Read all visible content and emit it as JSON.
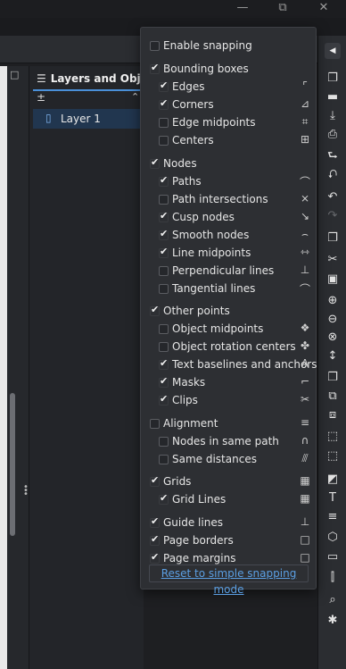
{
  "window_controls": {
    "minimize": "—",
    "maximize": "⧉",
    "close": "✕"
  },
  "layers_panel": {
    "tab_title": "Layers and Objec",
    "tab_icon": "☰",
    "add_glyph": "±",
    "up_glyph": "⌃",
    "layers": [
      {
        "name": "Layer 1",
        "icon": "▯"
      }
    ]
  },
  "snapping": {
    "options": [
      {
        "label": "Enable snapping",
        "checked": false,
        "level": 0,
        "icon": ""
      },
      {
        "label": "Bounding boxes",
        "checked": true,
        "level": 0,
        "icon": ""
      },
      {
        "label": "Edges",
        "checked": true,
        "level": 1,
        "icon": "⌜"
      },
      {
        "label": "Corners",
        "checked": true,
        "level": 1,
        "icon": "⊿"
      },
      {
        "label": "Edge midpoints",
        "checked": false,
        "level": 1,
        "icon": "⌗"
      },
      {
        "label": "Centers",
        "checked": false,
        "level": 1,
        "icon": "⊞"
      },
      {
        "label": "Nodes",
        "checked": true,
        "level": 0,
        "icon": ""
      },
      {
        "label": "Paths",
        "checked": true,
        "level": 1,
        "icon": "⌒"
      },
      {
        "label": "Path intersections",
        "checked": false,
        "level": 1,
        "icon": "⨯"
      },
      {
        "label": "Cusp nodes",
        "checked": true,
        "level": 1,
        "icon": "↘"
      },
      {
        "label": "Smooth nodes",
        "checked": true,
        "level": 1,
        "icon": "⌢"
      },
      {
        "label": "Line midpoints",
        "checked": true,
        "level": 1,
        "icon": "⇿"
      },
      {
        "label": "Perpendicular lines",
        "checked": false,
        "level": 1,
        "icon": "⊥"
      },
      {
        "label": "Tangential lines",
        "checked": false,
        "level": 1,
        "icon": "⌒"
      },
      {
        "label": "Other points",
        "checked": true,
        "level": 0,
        "icon": ""
      },
      {
        "label": "Object midpoints",
        "checked": false,
        "level": 1,
        "icon": "❖"
      },
      {
        "label": "Object rotation centers",
        "checked": false,
        "level": 1,
        "icon": "✤"
      },
      {
        "label": "Text baselines and anchors",
        "checked": true,
        "level": 1,
        "icon": "A"
      },
      {
        "label": "Masks",
        "checked": true,
        "level": 1,
        "icon": "⌐"
      },
      {
        "label": "Clips",
        "checked": true,
        "level": 1,
        "icon": "✂"
      },
      {
        "label": "Alignment",
        "checked": false,
        "level": 0,
        "icon": "≡"
      },
      {
        "label": "Nodes in same path",
        "checked": false,
        "level": 1,
        "icon": "∩"
      },
      {
        "label": "Same distances",
        "checked": false,
        "level": 1,
        "icon": "⫻"
      },
      {
        "label": "Grids",
        "checked": true,
        "level": 0,
        "icon": "▦"
      },
      {
        "label": "Grid Lines",
        "checked": true,
        "level": 1,
        "icon": "▦"
      },
      {
        "label": "Guide lines",
        "checked": true,
        "level": 0,
        "icon": "⊥"
      },
      {
        "label": "Page borders",
        "checked": true,
        "level": 0,
        "icon": "□"
      },
      {
        "label": "Page margins",
        "checked": true,
        "level": 0,
        "icon": "□"
      }
    ],
    "reset_link": "Reset to simple snapping mode"
  },
  "toolbar": {
    "collapse_icon": "◀",
    "buttons": [
      {
        "name": "new-document",
        "glyph": "❐",
        "enabled": true
      },
      {
        "name": "open",
        "glyph": "▬",
        "enabled": true
      },
      {
        "name": "save",
        "glyph": "⤓",
        "enabled": true
      },
      {
        "name": "print",
        "glyph": "⎙",
        "enabled": true
      },
      {
        "name": "import",
        "glyph": "⮑",
        "enabled": true
      },
      {
        "name": "export",
        "glyph": "⮏",
        "enabled": true
      },
      {
        "name": "undo",
        "glyph": "↶",
        "enabled": true
      },
      {
        "name": "redo",
        "glyph": "↷",
        "enabled": false
      },
      {
        "name": "copy",
        "glyph": "❐",
        "enabled": true
      },
      {
        "name": "cut",
        "glyph": "✂",
        "enabled": true
      },
      {
        "name": "paste",
        "glyph": "▣",
        "enabled": true
      },
      {
        "name": "zoom-selection",
        "glyph": "⊕",
        "enabled": true
      },
      {
        "name": "zoom-drawing",
        "glyph": "⊖",
        "enabled": true
      },
      {
        "name": "zoom-page",
        "glyph": "⊗",
        "enabled": true
      },
      {
        "name": "zoom-width",
        "glyph": "↕",
        "enabled": true
      },
      {
        "name": "duplicate",
        "glyph": "❐",
        "enabled": true
      },
      {
        "name": "clone",
        "glyph": "⧉",
        "enabled": true
      },
      {
        "name": "unlink-clone",
        "glyph": "⧈",
        "enabled": true
      },
      {
        "name": "group",
        "glyph": "⬚",
        "enabled": true
      },
      {
        "name": "ungroup",
        "glyph": "⬚",
        "enabled": true
      },
      {
        "name": "fill-stroke",
        "glyph": "◩",
        "enabled": true
      },
      {
        "name": "text-font",
        "glyph": "T",
        "enabled": true
      },
      {
        "name": "layers",
        "glyph": "≡",
        "enabled": true
      },
      {
        "name": "xml-editor",
        "glyph": "⬡",
        "enabled": true
      },
      {
        "name": "document-properties",
        "glyph": "▭",
        "enabled": true
      },
      {
        "name": "align-distribute",
        "glyph": "⫿",
        "enabled": true
      },
      {
        "name": "find",
        "glyph": "⌕",
        "enabled": true
      },
      {
        "name": "preferences",
        "glyph": "✱",
        "enabled": true
      }
    ]
  }
}
